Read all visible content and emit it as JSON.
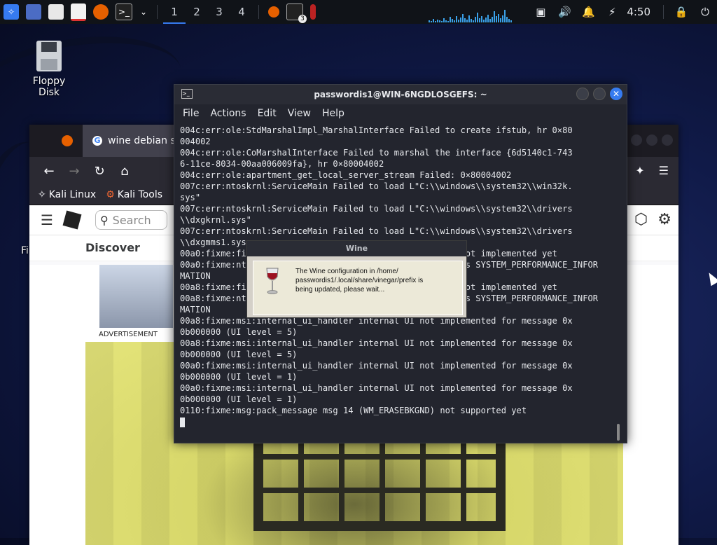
{
  "taskbar": {
    "workspaces": [
      "1",
      "2",
      "3",
      "4"
    ],
    "terminal_badge": "3",
    "clock": "4:50"
  },
  "desktop": {
    "floppy_label": "Floppy Disk",
    "partial_label": "Fi"
  },
  "firefox": {
    "tab_title": "wine debian s",
    "bookmarks": [
      "Kali Linux",
      "Kali Tools"
    ],
    "search_placeholder": "Search",
    "discover": "Discover",
    "advertisement": "ADVERTISEMENT"
  },
  "terminal": {
    "title": "passwordis1@WIN-6NGDLOSGEFS: ~",
    "menu": [
      "File",
      "Actions",
      "Edit",
      "View",
      "Help"
    ],
    "lines": [
      "004c:err:ole:StdMarshalImpl_MarshalInterface Failed to create ifstub, hr 0×80",
      "004002",
      "004c:err:ole:CoMarshalInterface Failed to marshal the interface {6d5140c1-743",
      "6-11ce-8034-00aa006009fa}, hr 0×80004002",
      "004c:err:ole:apartment_get_local_server_stream Failed: 0×80004002",
      "007c:err:ntoskrnl:ServiceMain Failed to load L\"C:\\\\windows\\\\system32\\\\win32k.",
      "sys\"",
      "007c:err:ntoskrnl:ServiceMain Failed to load L\"C:\\\\windows\\\\system32\\\\drivers",
      "\\\\dxgkrnl.sys\"",
      "007c:err:ntoskrnl:ServiceMain Failed to load L\"C:\\\\windows\\\\system32\\\\drivers",
      "\\\\dxgmms1.sys",
      "00a0:fixme:fi                                           ot implemented yet",
      "00a0:fixme:nt                                           s SYSTEM_PERFORMANCE_INFOR",
      "MATION",
      "00a8:fixme:fi                                           ot implemented yet",
      "00a8:fixme:nt                                           s SYSTEM_PERFORMANCE_INFOR",
      "MATION",
      "00a8:fixme:msi:internal_ui_handler internal UI not implemented for message 0x",
      "0b000000 (UI level = 5)",
      "00a8:fixme:msi:internal_ui_handler internal UI not implemented for message 0x",
      "0b000000 (UI level = 5)",
      "00a0:fixme:msi:internal_ui_handler internal UI not implemented for message 0x",
      "0b000000 (UI level = 1)",
      "00a0:fixme:msi:internal_ui_handler internal UI not implemented for message 0x",
      "0b000000 (UI level = 1)",
      "0110:fixme:msg:pack_message msg 14 (WM_ERASEBKGND) not supported yet"
    ]
  },
  "wine_dialog": {
    "title": "Wine",
    "message": "The Wine configuration in /home/\npasswordis1/.local/share/vinegar/prefix is\nbeing updated, please wait..."
  },
  "colors": {
    "accent": "#367bf0",
    "terminal_bg": "#23252e",
    "taskbar_bg": "#101318"
  }
}
